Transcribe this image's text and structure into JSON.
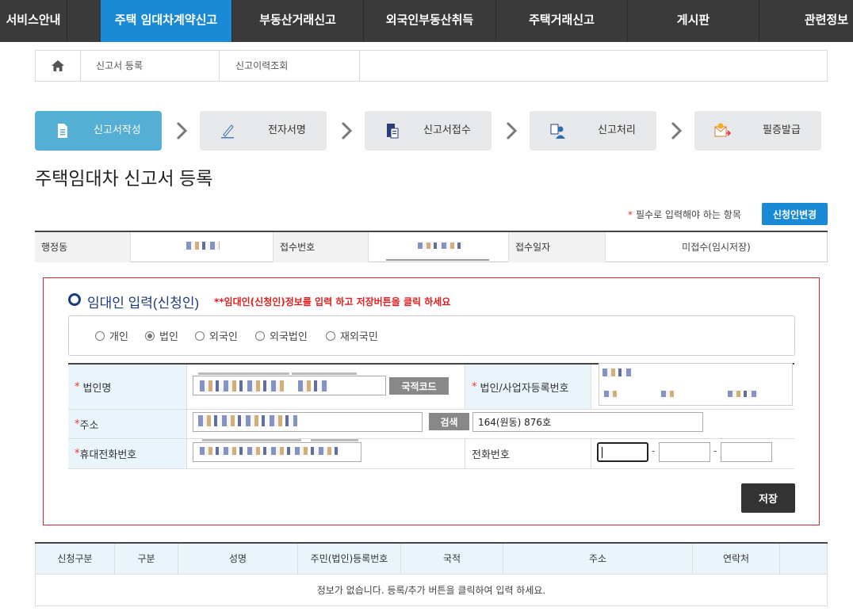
{
  "nav": {
    "items": [
      "서비스안내",
      "주택 임대차계약신고",
      "부동산거래신고",
      "외국인부동산취득",
      "주택거래신고",
      "게시판",
      "관련정보"
    ],
    "active_index": 1
  },
  "subnav": {
    "home_icon": "home-icon",
    "items": [
      "신고서 등록",
      "신고이력조회"
    ]
  },
  "steps": [
    {
      "label": "신고서작성",
      "icon": "document-icon",
      "active": true
    },
    {
      "label": "전자서명",
      "icon": "pen-icon",
      "active": false
    },
    {
      "label": "신고서접수",
      "icon": "file-stack-icon",
      "active": false
    },
    {
      "label": "신고처리",
      "icon": "person-doc-icon",
      "active": false
    },
    {
      "label": "필증발급",
      "icon": "certificate-icon",
      "active": false
    }
  ],
  "page_title": "주택임대차 신고서 등록",
  "required_note": "필수로 입력해야 하는 항목",
  "required_star": "*",
  "change_applicant_button": "신청인변경",
  "info": {
    "admin_dong_label": "행정동",
    "receipt_no_label": "접수번호",
    "receipt_date_label": "접수일자",
    "receipt_date_value": "미접수(임시저장)"
  },
  "section": {
    "title": "임대인 입력(신청인)",
    "note": "**임대인(신청인)정보를 입력 하고 저장버튼을 클릭 하세요"
  },
  "radios": [
    {
      "label": "개인",
      "checked": false
    },
    {
      "label": "법인",
      "checked": true
    },
    {
      "label": "외국인",
      "checked": false
    },
    {
      "label": "외국법인",
      "checked": false
    },
    {
      "label": "재외국민",
      "checked": false
    }
  ],
  "form": {
    "corp_name_label": "법인명",
    "country_code_button": "국적코드",
    "biz_reg_label": "법인/사업자등록번호",
    "address_label": "주소",
    "search_button": "검색",
    "address_detail_value": "164(원동) 876호",
    "mobile_label": "휴대전화번호",
    "phone_label": "전화번호",
    "phone_sep": "-"
  },
  "save_button": "저장",
  "table": {
    "headers": [
      "신청구분",
      "구분",
      "성명",
      "주민(법인)등록번호",
      "국적",
      "주소",
      "연락처"
    ],
    "empty_message": "정보가 없습니다.   등록/추가 버튼을 클릭하여 입력 하세요."
  }
}
